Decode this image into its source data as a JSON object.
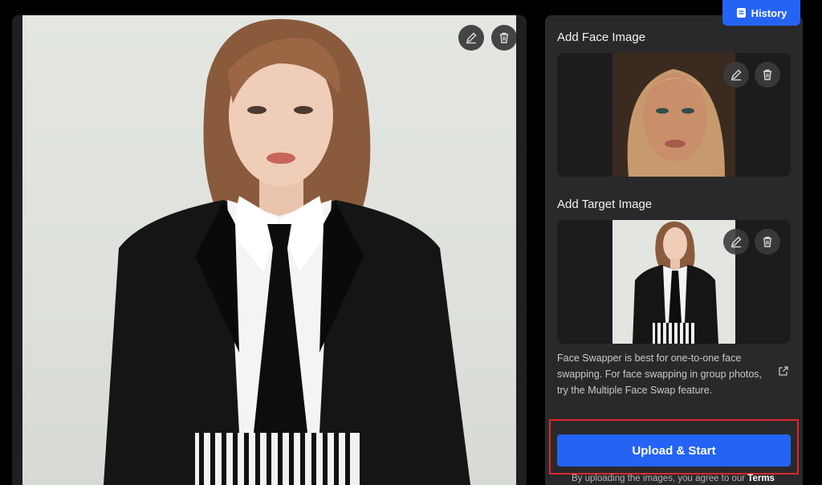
{
  "header": {
    "history_label": "History"
  },
  "preview": {
    "edit_icon": "pencil-icon",
    "delete_icon": "trash-icon"
  },
  "face_section": {
    "title": "Add Face Image"
  },
  "target_section": {
    "title": "Add Target Image"
  },
  "note": {
    "text": "Face Swapper is best for one-to-one face swapping. For face swapping in group photos, try the Multiple Face Swap feature."
  },
  "actions": {
    "upload_label": "Upload & Start"
  },
  "footer": {
    "disclaimer_prefix": "By uploading the images, you agree to our ",
    "terms_label": "Terms"
  },
  "colors": {
    "accent": "#2563f5",
    "highlight": "#e0252b",
    "panel": "#29292c"
  }
}
